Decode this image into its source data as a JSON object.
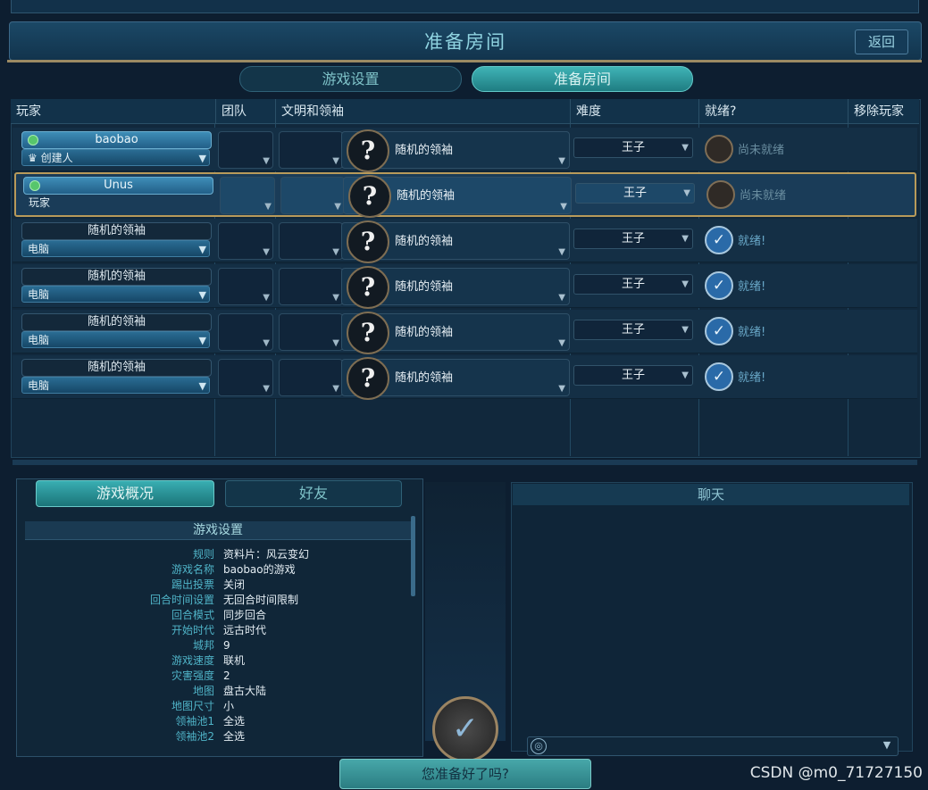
{
  "header": {
    "title": "准备房间",
    "back_label": "返回"
  },
  "tabs": [
    {
      "label": "游戏设置",
      "active": false
    },
    {
      "label": "准备房间",
      "active": true
    }
  ],
  "columns": [
    "玩家",
    "团队",
    "文明和领袖",
    "难度",
    "就绪?",
    "移除玩家"
  ],
  "players": [
    {
      "name": "baobao",
      "role": "创建人",
      "leader": "随机的领袖",
      "difficulty": "王子",
      "ready": "尚未就绪",
      "is_ready": false
    },
    {
      "name": "Unus",
      "role": "玩家",
      "leader": "随机的领袖",
      "difficulty": "王子",
      "ready": "尚未就绪",
      "is_ready": false
    },
    {
      "name": "随机的领袖",
      "role": "电脑",
      "leader": "随机的领袖",
      "difficulty": "王子",
      "ready": "就绪!",
      "is_ready": true
    },
    {
      "name": "随机的领袖",
      "role": "电脑",
      "leader": "随机的领袖",
      "difficulty": "王子",
      "ready": "就绪!",
      "is_ready": true
    },
    {
      "name": "随机的领袖",
      "role": "电脑",
      "leader": "随机的领袖",
      "difficulty": "王子",
      "ready": "就绪!",
      "is_ready": true
    },
    {
      "name": "随机的领袖",
      "role": "电脑",
      "leader": "随机的领袖",
      "difficulty": "王子",
      "ready": "就绪!",
      "is_ready": true
    }
  ],
  "bottom_tabs": [
    {
      "label": "游戏概况",
      "active": true
    },
    {
      "label": "好友",
      "active": false
    }
  ],
  "settings_title": "游戏设置",
  "settings": [
    {
      "k": "规则",
      "v": "资料片：风云变幻"
    },
    {
      "k": "游戏名称",
      "v": "baobao的游戏"
    },
    {
      "k": "踢出投票",
      "v": "关闭"
    },
    {
      "k": "回合时间设置",
      "v": "无回合时间限制"
    },
    {
      "k": "回合模式",
      "v": "同步回合"
    },
    {
      "k": "开始时代",
      "v": "远古时代"
    },
    {
      "k": "城邦",
      "v": "9"
    },
    {
      "k": "游戏速度",
      "v": "联机"
    },
    {
      "k": "灾害强度",
      "v": "2"
    },
    {
      "k": "地图",
      "v": "盘古大陆"
    },
    {
      "k": "地图尺寸",
      "v": "小"
    },
    {
      "k": "领袖池1",
      "v": "全选"
    },
    {
      "k": "领袖池2",
      "v": "全选"
    }
  ],
  "chat_title": "聊天",
  "ready_prompt": "您准备好了吗?",
  "watermark": "CSDN @m0_71727150",
  "colors": {
    "accent": "#3fb3b6",
    "gold": "#9b8a63",
    "background": "#0d1e30"
  },
  "icons": {
    "question": "?",
    "check": "✓",
    "arrow": "▼",
    "globe": "🌐"
  }
}
